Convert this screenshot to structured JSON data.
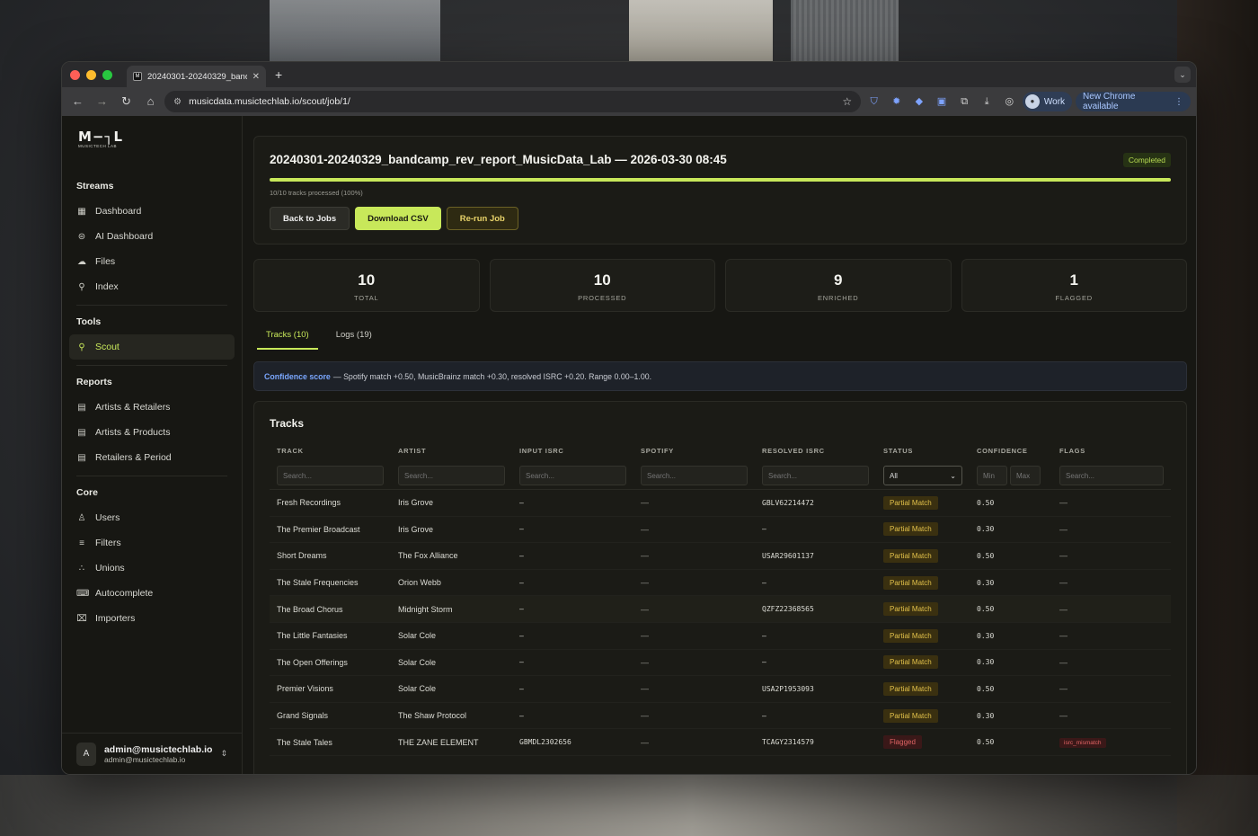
{
  "browser": {
    "tab_title": "20240301-20240329_bandc",
    "url": "musicdata.musictechlab.io/scout/job/1/",
    "profile_label": "Work",
    "update_label": "New Chrome available"
  },
  "sidebar": {
    "logo_mark": "M−┐L",
    "logo_sub": "MUSICTECH LAB",
    "sections": [
      {
        "heading": "Streams",
        "items": [
          "Dashboard",
          "AI Dashboard",
          "Files",
          "Index"
        ]
      },
      {
        "heading": "Tools",
        "items": [
          "Scout"
        ]
      },
      {
        "heading": "Reports",
        "items": [
          "Artists & Retailers",
          "Artists & Products",
          "Retailers & Period"
        ]
      },
      {
        "heading": "Core",
        "items": [
          "Users",
          "Filters",
          "Unions",
          "Autocomplete",
          "Importers"
        ]
      }
    ],
    "user": {
      "initial": "A",
      "name": "admin@musictechlab.io",
      "email": "admin@musictechlab.io"
    }
  },
  "job": {
    "title": "20240301-20240329_bandcamp_rev_report_MusicData_Lab — 2026-03-30 08:45",
    "status": "Completed",
    "progress_fraction": 1.0,
    "progress_label": "10/10 tracks processed (100%)",
    "buttons": {
      "back": "Back to Jobs",
      "download": "Download CSV",
      "rerun": "Re-run Job"
    }
  },
  "stats": [
    {
      "value": "10",
      "label": "TOTAL"
    },
    {
      "value": "10",
      "label": "PROCESSED"
    },
    {
      "value": "9",
      "label": "ENRICHED"
    },
    {
      "value": "1",
      "label": "FLAGGED"
    }
  ],
  "tabs": [
    "Tracks (10)",
    "Logs (19)"
  ],
  "info": {
    "link": "Confidence score",
    "text": "— Spotify match +0.50, MusicBrainz match +0.30, resolved ISRC +0.20. Range 0.00–1.00."
  },
  "tracks": {
    "title": "Tracks",
    "columns": [
      "TRACK",
      "ARTIST",
      "INPUT ISRC",
      "SPOTIFY",
      "RESOLVED ISRC",
      "STATUS",
      "CONFIDENCE",
      "FLAGS"
    ],
    "search_placeholder": "Search...",
    "status_filter": "All",
    "min_placeholder": "Min",
    "max_placeholder": "Max",
    "rows": [
      {
        "track": "Fresh Recordings",
        "artist": "Iris Grove",
        "input_isrc": "–",
        "spotify": "—",
        "resolved_isrc": "GBLV62214472",
        "status": "Partial Match",
        "confidence": "0.50",
        "flags": "—"
      },
      {
        "track": "The Premier Broadcast",
        "artist": "Iris Grove",
        "input_isrc": "–",
        "spotify": "—",
        "resolved_isrc": "–",
        "status": "Partial Match",
        "confidence": "0.30",
        "flags": "—"
      },
      {
        "track": "Short Dreams",
        "artist": "The Fox Alliance",
        "input_isrc": "–",
        "spotify": "—",
        "resolved_isrc": "USAR29601137",
        "status": "Partial Match",
        "confidence": "0.50",
        "flags": "—"
      },
      {
        "track": "The Stale Frequencies",
        "artist": "Orion Webb",
        "input_isrc": "–",
        "spotify": "—",
        "resolved_isrc": "–",
        "status": "Partial Match",
        "confidence": "0.30",
        "flags": "—"
      },
      {
        "track": "The Broad Chorus",
        "artist": "Midnight Storm",
        "input_isrc": "–",
        "spotify": "—",
        "resolved_isrc": "QZFZ22368565",
        "status": "Partial Match",
        "confidence": "0.50",
        "flags": "—"
      },
      {
        "track": "The Little Fantasies",
        "artist": "Solar Cole",
        "input_isrc": "–",
        "spotify": "—",
        "resolved_isrc": "–",
        "status": "Partial Match",
        "confidence": "0.30",
        "flags": "—"
      },
      {
        "track": "The Open Offerings",
        "artist": "Solar Cole",
        "input_isrc": "–",
        "spotify": "—",
        "resolved_isrc": "–",
        "status": "Partial Match",
        "confidence": "0.30",
        "flags": "—"
      },
      {
        "track": "Premier Visions",
        "artist": "Solar Cole",
        "input_isrc": "–",
        "spotify": "—",
        "resolved_isrc": "USA2P1953093",
        "status": "Partial Match",
        "confidence": "0.50",
        "flags": "—"
      },
      {
        "track": "Grand Signals",
        "artist": "The Shaw Protocol",
        "input_isrc": "–",
        "spotify": "—",
        "resolved_isrc": "–",
        "status": "Partial Match",
        "confidence": "0.30",
        "flags": "—"
      },
      {
        "track": "The Stale Tales",
        "artist": "THE ZANE ELEMENT",
        "input_isrc": "GBMDL2302656",
        "spotify": "—",
        "resolved_isrc": "TCAGY2314579",
        "status": "Flagged",
        "confidence": "0.50",
        "flags": "isrc_mismatch"
      }
    ]
  },
  "colors": {
    "accent": "#c8e85a",
    "partial": "#e2c14a",
    "flagged": "#e06464",
    "link": "#7aa7ff"
  }
}
